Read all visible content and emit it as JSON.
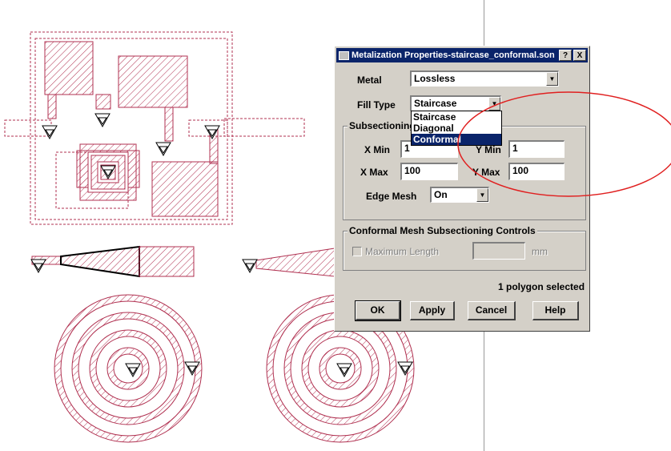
{
  "dialog": {
    "title": "Metalization Properties-staircase_conformal.son",
    "help_btn": "?",
    "close_btn": "X",
    "metal_label": "Metal",
    "metal_value": "Lossless",
    "fill_type_label": "Fill Type",
    "fill_type_value": "Staircase",
    "fill_type_options": [
      "Staircase",
      "Diagonal",
      "Conformal"
    ],
    "fill_type_highlighted": "Conformal",
    "subsectioning_title": "Subsectioning",
    "x_min_label": "X Min",
    "x_min_value": "1",
    "y_min_label": "Y Min",
    "y_min_value": "1",
    "x_max_label": "X Max",
    "x_max_value": "100",
    "y_max_label": "Y Max",
    "y_max_value": "100",
    "edge_mesh_label": "Edge Mesh",
    "edge_mesh_value": "On",
    "conformal_title": "Conformal Mesh Subsectioning Controls",
    "max_length_label": "Maximum Length",
    "max_length_value": "",
    "unit_label": "mm",
    "status_text": "1 polygon selected",
    "buttons": {
      "ok": "OK",
      "apply": "Apply",
      "cancel": "Cancel",
      "help": "Help"
    }
  },
  "colors": {
    "layout_stroke": "#b03050",
    "annotation_ellipse": "#e02020",
    "title_bar": "#0a246a",
    "dialog_face": "#d4d0c8"
  }
}
